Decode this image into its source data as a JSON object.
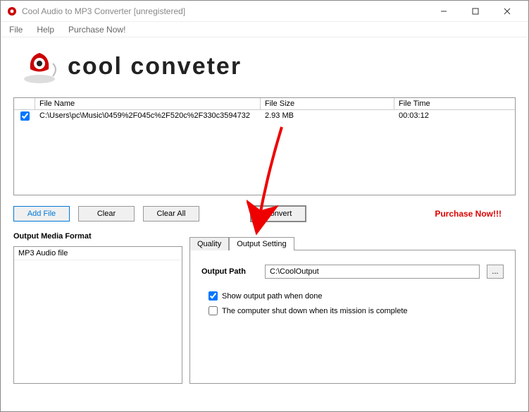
{
  "window": {
    "title": "Cool Audio to MP3 Converter  [unregistered]"
  },
  "menu": {
    "file": "File",
    "help": "Help",
    "purchase": "Purchase Now!"
  },
  "logo": {
    "text": "cool conveter"
  },
  "table": {
    "headers": {
      "name": "File Name",
      "size": "File Size",
      "time": "File Time"
    },
    "rows": [
      {
        "checked": true,
        "name": "C:\\Users\\pc\\Music\\0459%2F045c%2F520c%2F330c3594732",
        "size": "2.93 MB",
        "time": "00:03:12"
      }
    ]
  },
  "buttons": {
    "add": "Add File",
    "clear": "Clear",
    "clearall": "Clear All",
    "convert": "Convert"
  },
  "purchase_link": "Purchase Now!!!",
  "format": {
    "title": "Output Media Format",
    "items": [
      "MP3 Audio file"
    ]
  },
  "tabs": {
    "quality": "Quality",
    "output": "Output Setting"
  },
  "output": {
    "path_label": "Output Path",
    "path_value": "C:\\CoolOutput",
    "browse": "...",
    "show_path": "Show output path when done",
    "shutdown": "The computer shut down when its mission is complete"
  }
}
